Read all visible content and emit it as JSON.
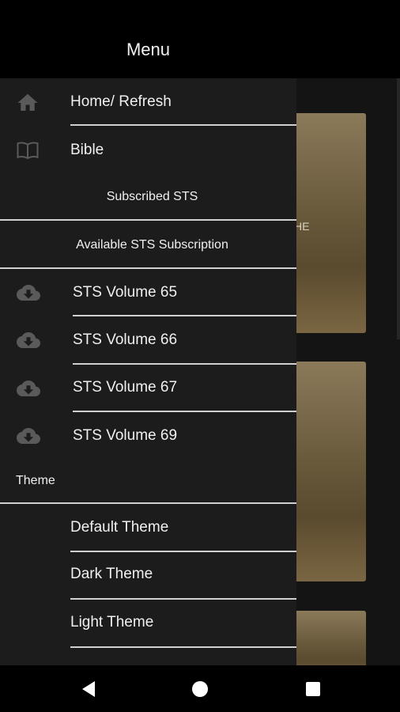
{
  "header": {
    "title": "Menu"
  },
  "background": {
    "card_peek_text": "HE"
  },
  "drawer": {
    "items": [
      {
        "label": "Home/ Refresh",
        "icon": "home-icon"
      },
      {
        "label": "Bible",
        "icon": "book-icon"
      }
    ],
    "subscribed_header": "Subscribed STS",
    "available_header": "Available STS Subscription",
    "volumes": [
      {
        "label": "STS Volume 65",
        "icon": "cloud-download-icon"
      },
      {
        "label": "STS Volume 66",
        "icon": "cloud-download-icon"
      },
      {
        "label": "STS Volume 67",
        "icon": "cloud-download-icon"
      },
      {
        "label": "STS Volume 69",
        "icon": "cloud-download-icon"
      }
    ],
    "theme_header": "Theme",
    "themes": [
      {
        "label": "Default Theme"
      },
      {
        "label": "Dark Theme"
      },
      {
        "label": "Light Theme"
      }
    ]
  },
  "navbar": {
    "buttons": [
      "back",
      "home",
      "recents"
    ]
  },
  "colors": {
    "drawer_bg": "#1c1c1c",
    "divider": "#d0d0d0",
    "icon_gray": "#5a5a5a"
  }
}
